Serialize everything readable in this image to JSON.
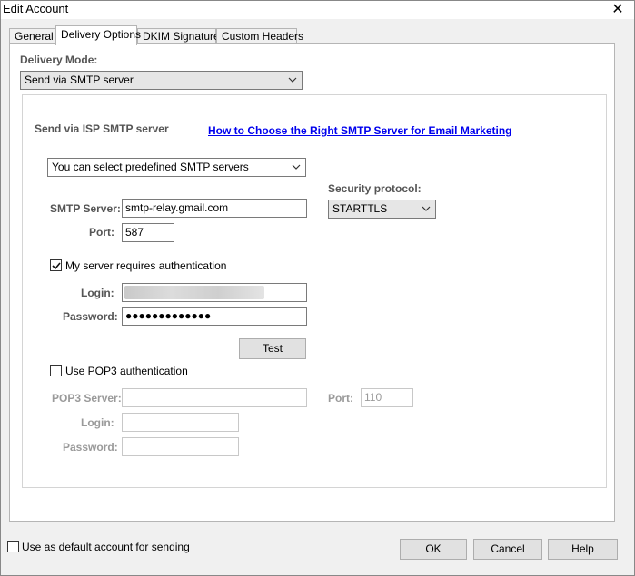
{
  "window": {
    "title": "Edit Account",
    "close_glyph": "✕"
  },
  "tabs": [
    {
      "label": "General"
    },
    {
      "label": "Delivery Options"
    },
    {
      "label": "DKIM Signature"
    },
    {
      "label": "Custom Headers"
    }
  ],
  "delivery": {
    "mode_label": "Delivery Mode:",
    "mode_value": "Send via SMTP server",
    "section_title": "Send via ISP SMTP server",
    "help_link": "How to Choose the Right SMTP Server for Email Marketing",
    "predefined_value": "You can select predefined SMTP servers",
    "smtp_server_label": "SMTP Server:",
    "smtp_server_value": "smtp-relay.gmail.com",
    "port_label": "Port:",
    "port_value": "587",
    "security_label": "Security protocol:",
    "security_value": "STARTTLS",
    "auth_label": "My server requires authentication",
    "auth_checked": true,
    "login_label": "Login:",
    "password_label": "Password:",
    "password_mask": "●●●●●●●●●●●●●",
    "test_button": "Test",
    "pop3_label": "Use POP3 authentication",
    "pop3_checked": false,
    "pop3_server_label": "POP3 Server:",
    "pop3_port_label": "Port:",
    "pop3_port_value": "110",
    "pop3_login_label": "Login:",
    "pop3_password_label": "Password:"
  },
  "footer": {
    "default_label": "Use as default account for sending",
    "default_checked": false,
    "ok": "OK",
    "cancel": "Cancel",
    "help": "Help"
  }
}
